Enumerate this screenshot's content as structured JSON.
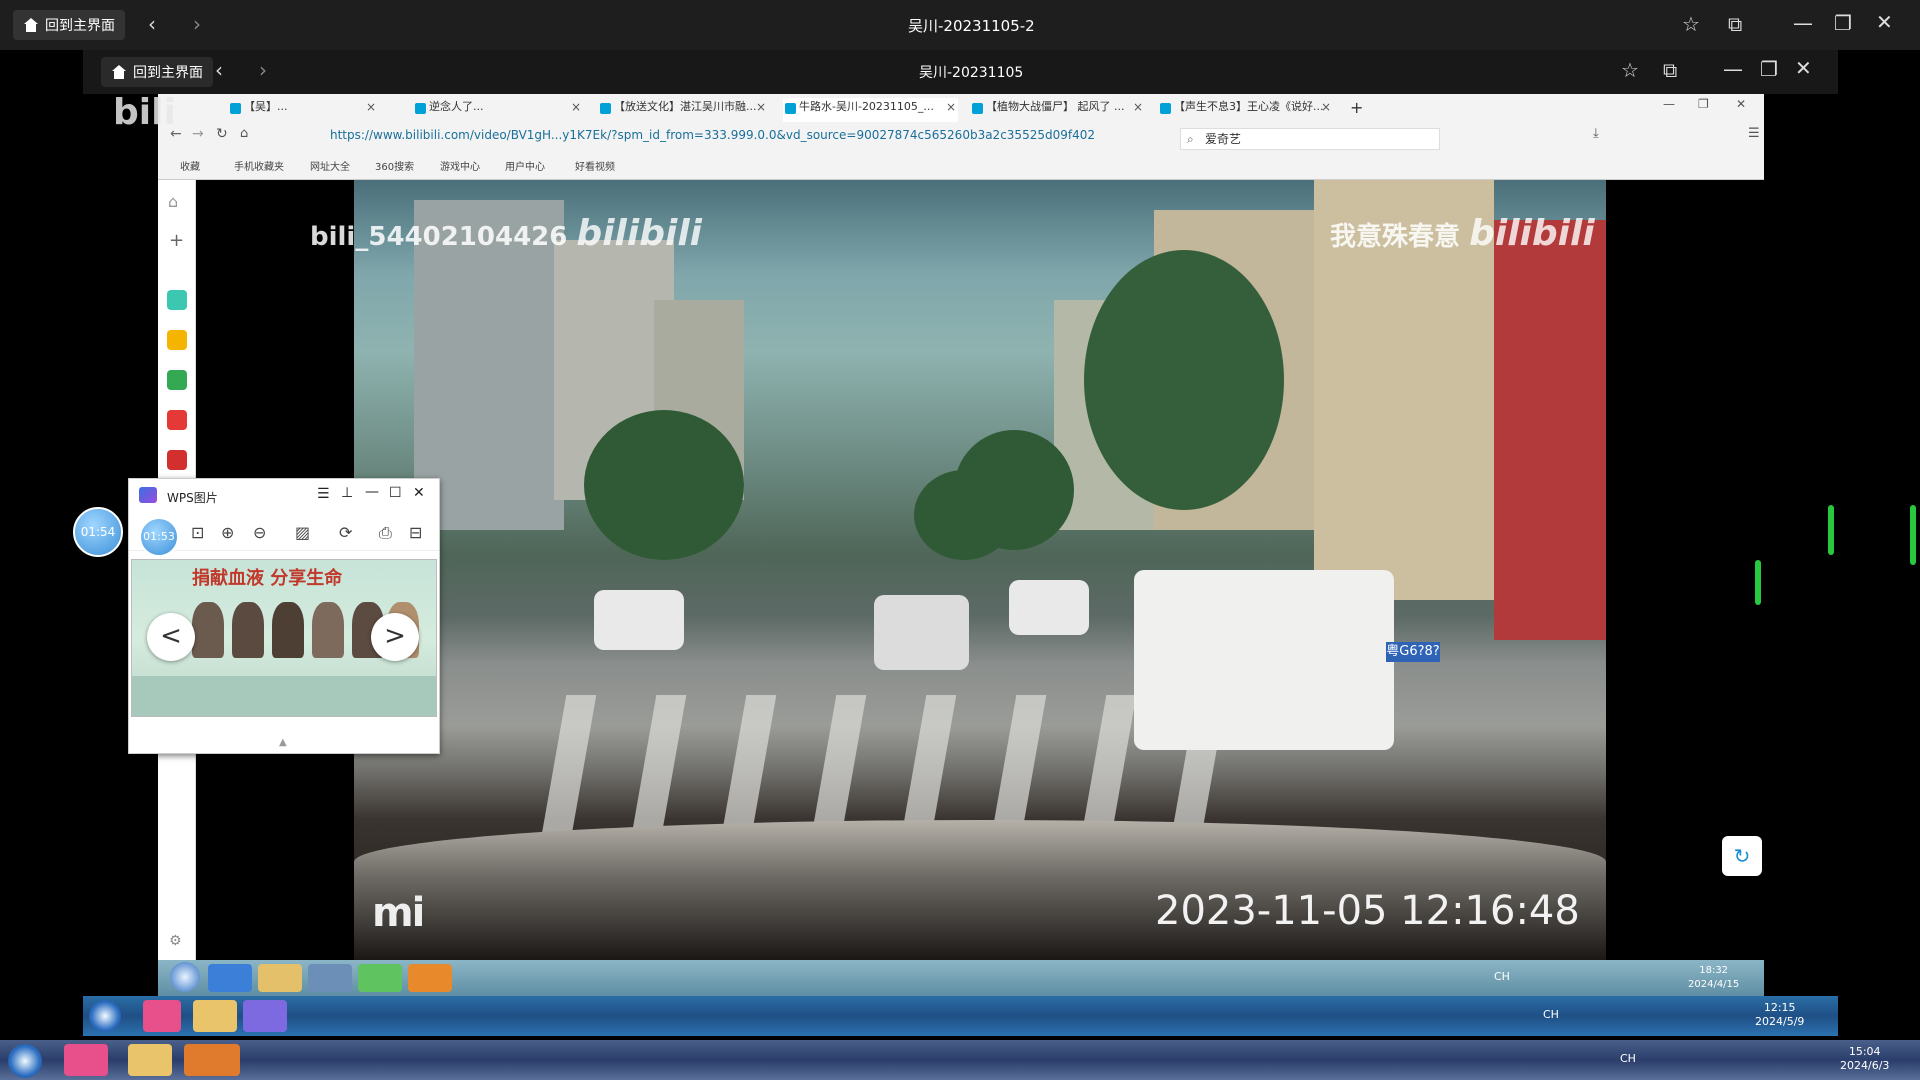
{
  "outer": {
    "home_label": "回到主界面",
    "title": "吴川-20231105-2"
  },
  "inner": {
    "home_label": "回到主界面",
    "title": "吴川-20231105"
  },
  "overlay_text": "bili",
  "browser": {
    "tabs": [
      {
        "label": "【吴】...",
        "active": false
      },
      {
        "label": "逆念人了...",
        "active": false
      },
      {
        "label": "【放送文化】湛江吴川市融...",
        "active": false
      },
      {
        "label": "牛路水-吴川-20231105_...",
        "active": true
      },
      {
        "label": "【植物大战僵尸】 起风了 ...",
        "active": false
      },
      {
        "label": "【声生不息3】王心凌《说好...",
        "active": false
      }
    ],
    "address": "https://www.bilibili.com/video/BV1gH...y1K7Ek/?spm_id_from=333.999.0.0&vd_source=90027874c565260b3a2c35525d09f402",
    "search_placeholder": "爱奇艺",
    "bookmarks": [
      "收藏",
      "手机收藏夹",
      "网址大全",
      "360搜索",
      "游戏中心",
      "用户中心",
      "好看视频"
    ]
  },
  "video": {
    "watermark_left_user": "bili_54402104426",
    "watermark_right_user": "我意殊春意",
    "bili_logo": "bilibili",
    "brand_logo": "mi",
    "timestamp": "2023-11-05  12:16:48",
    "plate": "粤G6?8?"
  },
  "wps": {
    "title": "WPS图片",
    "timer": "01:53",
    "image_banner": "捐献血液 分享生命",
    "prev": "<",
    "next": ">"
  },
  "timer_outer": "01:54",
  "video_taskbar": {
    "tray_lang": "CH",
    "time": "18:32",
    "date": "2024/4/15"
  },
  "inner_taskbar": {
    "tray_lang": "CH",
    "time": "12:15",
    "date": "2024/5/9"
  },
  "outer_taskbar": {
    "tray_lang": "CH",
    "time": "15:04",
    "date": "2024/6/3"
  }
}
